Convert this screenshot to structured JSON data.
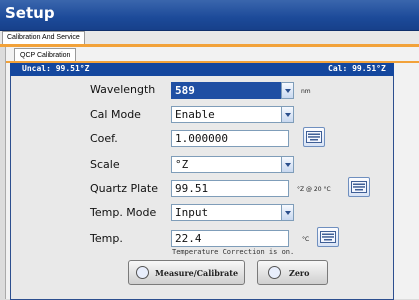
{
  "window": {
    "title": "Setup"
  },
  "tabs": {
    "outer": "Calibration And Service",
    "inner": "QCP Calibration"
  },
  "status": {
    "uncal": "Uncal: 99.51°Z",
    "cal": "Cal: 99.51°Z"
  },
  "form": {
    "wavelength": {
      "label": "Wavelength",
      "value": "589",
      "unit": "nm"
    },
    "cal_mode": {
      "label": "Cal Mode",
      "value": "Enable"
    },
    "coef": {
      "label": "Coef.",
      "value": "1.000000"
    },
    "scale": {
      "label": "Scale",
      "value": "°Z"
    },
    "quartz_plate": {
      "label": "Quartz Plate",
      "value": "99.51",
      "unit": "°Z @ 20 °C"
    },
    "temp_mode": {
      "label": "Temp. Mode",
      "value": "Input"
    },
    "temp": {
      "label": "Temp.",
      "value": "22.4",
      "unit": "°C"
    }
  },
  "note": "Temperature Correction is on.",
  "buttons": {
    "measure": "Measure/Calibrate",
    "zero": "Zero"
  },
  "colors": {
    "title_bar": "#1c4a99",
    "accent": "#f2a23a",
    "status_bar": "#14479e"
  }
}
